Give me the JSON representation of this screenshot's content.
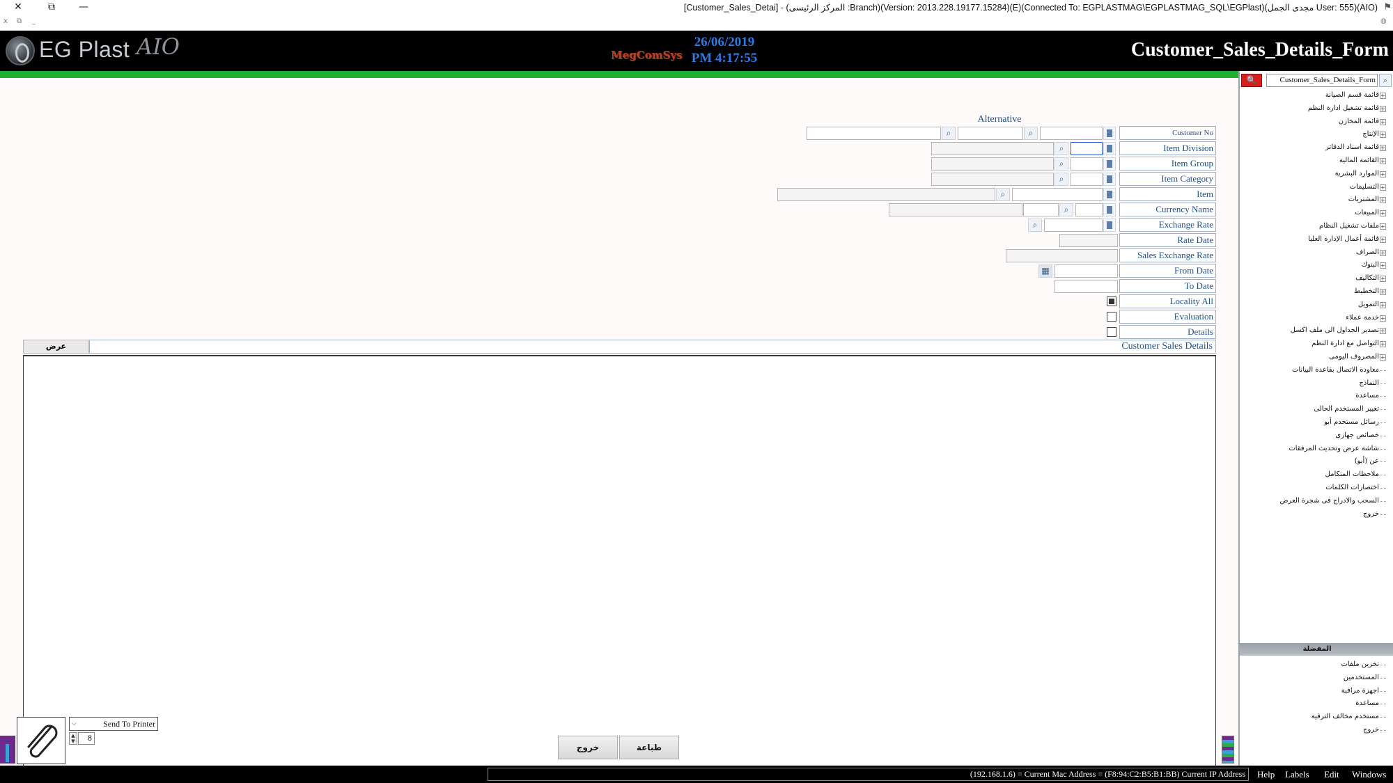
{
  "window": {
    "title": "[Customer_Sales_Detai] - (المركز الرئيسى :Branch)(Version: 2013.228.19177.15284)(E)(Connected To: EGPLASTMAG\\EGPLASTMAG_SQL\\EGPlast)(مجدى الجمل User: 555)(AIO)",
    "close_glyph": "✕",
    "restore_glyph": "⧉",
    "minimize_glyph": "—",
    "sub_close": "x",
    "sub_restore": "⧉",
    "sub_min": "_"
  },
  "header": {
    "logo_text": "EG Plast",
    "logo_suffix": "AIO",
    "brand": "MegComSys",
    "date": "26/06/2019",
    "time": "PM 4:17:55",
    "form_title": "Customer_Sales_Details_Form"
  },
  "form": {
    "alternative_label": "Alternative",
    "fields": {
      "customer_no": "Customer No",
      "item_division": "Item Division",
      "item_group": "Item Group",
      "item_category": "Item Category",
      "item": "Item",
      "currency_name": "Currency Name",
      "exchange_rate": "Exchange Rate",
      "rate_date": "Rate Date",
      "sales_exchange_rate": "Sales Exchange Rate",
      "from_date": "From Date",
      "to_date": "To Date",
      "locality_all": "Locality All",
      "evaluation": "Evaluation",
      "details": "Details"
    },
    "locality_all_checked": true,
    "evaluation_checked": false,
    "details_checked": false,
    "view_button": "عرض",
    "grid_caption": "Customer Sales Details",
    "search_glyph": "⌕"
  },
  "bottom": {
    "send_to_printer": "Send To Printer",
    "copies": "8",
    "exit_button": "خروج",
    "print_button": "طباعة"
  },
  "right_panel": {
    "search_value": "Customer_Sales_Details_Form",
    "search_btn_glyph": "🔍",
    "search_icon_glyph": "⌕",
    "tree_items": [
      "قائمة قسم الصيانة",
      "قائمة تشغيل ادارة النظم",
      "قائمة المخازن",
      "الإنتاج",
      "قائمة اسناد الدفاتر",
      "القائمة المالية",
      "الموارد البشرية",
      "التسليمات",
      "المشتريات",
      "المبيعات",
      "ملفات تشغيل النظام",
      "قائمة أعمال الإدارة العليا",
      "الصراف",
      "البنوك",
      "التكاليف",
      "التخطيط",
      "التمويل",
      "خدمة عملاء",
      "تصدير الجداول الى ملف اكسل",
      "التواصل مع ادارة النظم",
      "المصروف اليومى"
    ],
    "plain_items": [
      "معاودة الاتصال بقاعدة البيانات",
      "النماذج",
      "مساعدة",
      "تغيير المستخدم الحالى",
      "رسائل مستخدم أبو",
      "خصائص جهازى",
      "شاشة عرض وتحديث المرفقات",
      "عن (أبو)",
      "ملاحظات المتكامل",
      "اختصارات الكلمات",
      "السحب والادراج فى شجرة العرض",
      "خروج"
    ],
    "favorites_header": "المفضلة",
    "favorites": [
      "تخزين ملفات",
      "المستخدمين",
      "اجهزة مراقبة",
      "مساعدة",
      "مستخدم مخالف الترقية",
      "خروج"
    ]
  },
  "statusbar": {
    "info": "(192.168.1.6) = Current Mac Address = (F8:94:C2:B5:B1:BB) Current IP Address",
    "menu": [
      "Help",
      "Labels",
      "Edit",
      "Windows"
    ]
  },
  "colors": {
    "header_bg": "#000000",
    "accent_green": "#1fae2e",
    "label_blue": "#1e4f8e",
    "datetime_blue": "#2c7be5",
    "search_red": "#d61f1f"
  }
}
